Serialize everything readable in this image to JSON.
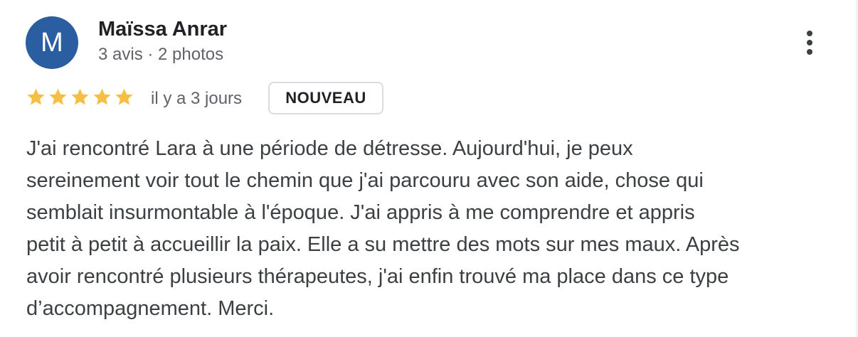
{
  "reviewer": {
    "avatar_letter": "M",
    "avatar_color": "#2a5ea0",
    "name": "Maïssa Anrar",
    "meta": "3 avis · 2 photos"
  },
  "menu": {
    "icon": "more-vert-icon"
  },
  "review": {
    "rating": 5,
    "rating_max": 5,
    "star_color": "#f4bf42",
    "date": "il y a 3 jours",
    "badge": "NOUVEAU",
    "text_lines": [
      "J'ai rencontré Lara à une période de détresse. Aujourd'hui, je peux",
      "sereinement voir tout le chemin que j'ai parcouru avec son aide, chose qui",
      "semblait insurmontable à l'époque. J'ai appris à me comprendre et appris",
      "petit à petit à accueillir la paix. Elle a su mettre des mots sur mes maux. Après",
      "avoir rencontré plusieurs thérapeutes, j'ai enfin trouvé ma place dans ce type",
      "d’accompagnement. Merci."
    ]
  }
}
